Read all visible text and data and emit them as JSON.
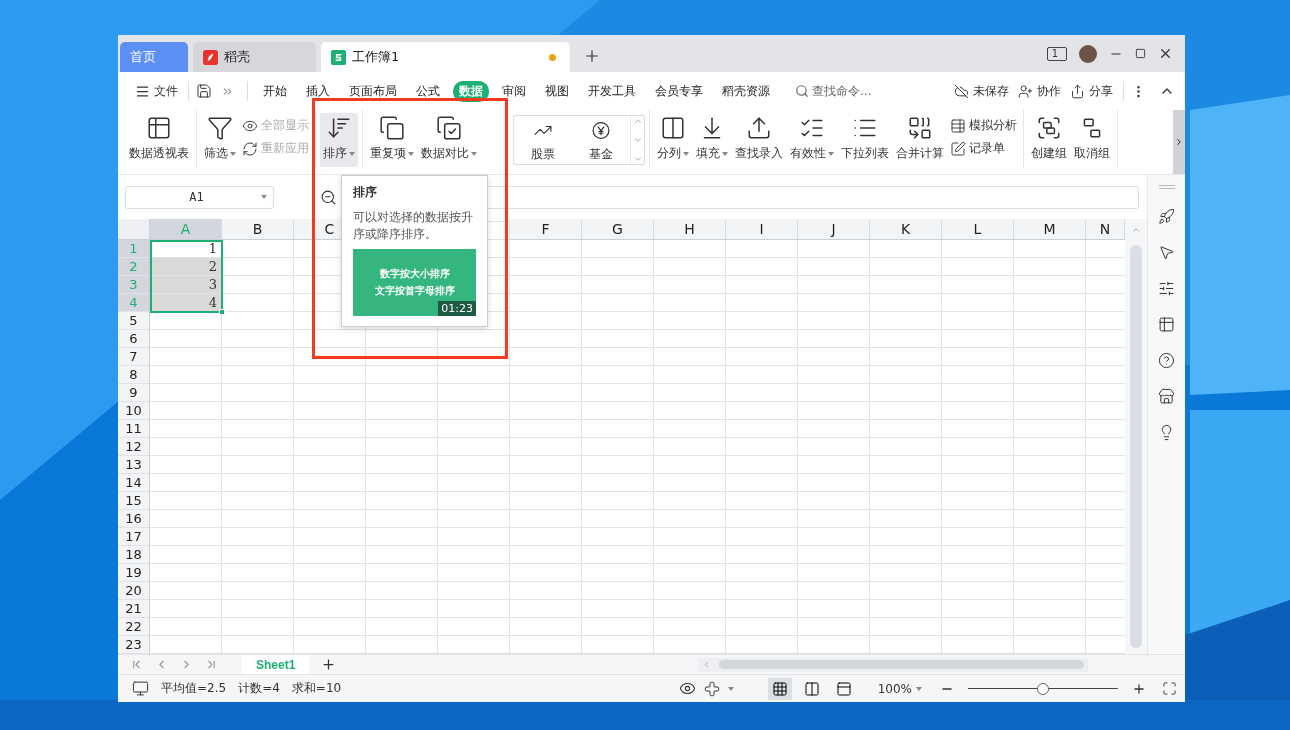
{
  "window_tabs": [
    {
      "label": "首页",
      "kind": "home",
      "selected": false
    },
    {
      "label": "稻壳",
      "kind": "docer",
      "selected": false
    },
    {
      "label": "工作簿1",
      "kind": "sheet",
      "selected": true,
      "unsaved": true
    }
  ],
  "window_count": "1",
  "menu": {
    "file": "文件",
    "tabs": [
      {
        "label": "开始",
        "selected": false
      },
      {
        "label": "插入",
        "selected": false
      },
      {
        "label": "页面布局",
        "selected": false
      },
      {
        "label": "公式",
        "selected": false
      },
      {
        "label": "数据",
        "selected": true
      },
      {
        "label": "审阅",
        "selected": false
      },
      {
        "label": "视图",
        "selected": false
      },
      {
        "label": "开发工具",
        "selected": false
      },
      {
        "label": "会员专享",
        "selected": false
      },
      {
        "label": "稻壳资源",
        "selected": false
      }
    ],
    "search": {
      "placeholder": "查找命令..."
    },
    "actions": [
      "未保存",
      "协作",
      "分享"
    ]
  },
  "ribbon_groups": [
    {
      "items": [
        {
          "kind": "large",
          "label": "数据透视表",
          "caret": false,
          "hovered": false
        }
      ]
    },
    {
      "items": [
        {
          "kind": "large",
          "label": "筛选",
          "caret": true,
          "hovered": false
        },
        {
          "kind": "pair",
          "entries": [
            {
              "label": "全部显示",
              "disabled": true
            },
            {
              "label": "重新应用",
              "disabled": true
            }
          ]
        }
      ]
    },
    {
      "items": [
        {
          "kind": "large",
          "label": "排序",
          "caret": true,
          "hovered": true
        }
      ]
    },
    {
      "items": [
        {
          "kind": "large",
          "label": "重复项",
          "caret": true,
          "hovered": false
        },
        {
          "kind": "large",
          "label": "数据对比",
          "caret": true,
          "hovered": false
        },
        {
          "kind": "gallery",
          "entries": [
            {
              "label": "股票"
            },
            {
              "label": "基金"
            }
          ]
        }
      ]
    },
    {
      "items": [
        {
          "kind": "large",
          "label": "分列",
          "caret": true,
          "hovered": false
        },
        {
          "kind": "large",
          "label": "填充",
          "caret": true,
          "hovered": false
        },
        {
          "kind": "large",
          "label": "查找录入",
          "caret": false,
          "hovered": false
        },
        {
          "kind": "large",
          "label": "有效性",
          "caret": true,
          "hovered": false
        },
        {
          "kind": "large",
          "label": "下拉列表",
          "caret": false,
          "hovered": false
        },
        {
          "kind": "large",
          "label": "合并计算",
          "caret": false,
          "hovered": false
        },
        {
          "kind": "pair",
          "entries": [
            {
              "label": "模拟分析",
              "disabled": false
            },
            {
              "label": "记录单",
              "disabled": false
            }
          ]
        }
      ]
    },
    {
      "items": [
        {
          "kind": "large",
          "label": "创建组",
          "caret": false,
          "hovered": false
        },
        {
          "kind": "large",
          "label": "取消组",
          "caret": false,
          "hovered": false
        }
      ]
    }
  ],
  "tooltip": {
    "title": "排序",
    "description": "可以对选择的数据按升序或降序排序。",
    "video": {
      "lines": [
        "数字按大小排序",
        "文字按首字母排序"
      ],
      "duration": "01:23"
    }
  },
  "name_box": {
    "value": "A1"
  },
  "columns": [
    {
      "label": "A",
      "selected": true
    },
    {
      "label": "B",
      "selected": false
    },
    {
      "label": "C",
      "selected": false
    },
    {
      "label": "F",
      "selected": false
    },
    {
      "label": "G",
      "selected": false
    },
    {
      "label": "H",
      "selected": false
    },
    {
      "label": "I",
      "selected": false
    },
    {
      "label": "J",
      "selected": false
    },
    {
      "label": "K",
      "selected": false
    },
    {
      "label": "L",
      "selected": false
    },
    {
      "label": "M",
      "selected": false
    },
    {
      "label": "N",
      "selected": false
    }
  ],
  "rows": [
    {
      "label": "1",
      "selected": true,
      "cells": [
        {
          "value": "1",
          "shaded": false
        }
      ]
    },
    {
      "label": "2",
      "selected": true,
      "cells": [
        {
          "value": "2",
          "shaded": true
        }
      ]
    },
    {
      "label": "3",
      "selected": true,
      "cells": [
        {
          "value": "3",
          "shaded": true
        }
      ]
    },
    {
      "label": "4",
      "selected": true,
      "cells": [
        {
          "value": "4",
          "shaded": true
        }
      ]
    },
    {
      "label": "5",
      "selected": false,
      "cells": []
    },
    {
      "label": "6",
      "selected": false,
      "cells": []
    },
    {
      "label": "7",
      "selected": false,
      "cells": []
    },
    {
      "label": "8",
      "selected": false,
      "cells": []
    },
    {
      "label": "9",
      "selected": false,
      "cells": []
    },
    {
      "label": "10",
      "selected": false,
      "cells": []
    },
    {
      "label": "11",
      "selected": false,
      "cells": []
    },
    {
      "label": "12",
      "selected": false,
      "cells": []
    },
    {
      "label": "13",
      "selected": false,
      "cells": []
    },
    {
      "label": "14",
      "selected": false,
      "cells": []
    },
    {
      "label": "15",
      "selected": false,
      "cells": []
    },
    {
      "label": "16",
      "selected": false,
      "cells": []
    },
    {
      "label": "17",
      "selected": false,
      "cells": []
    },
    {
      "label": "18",
      "selected": false,
      "cells": []
    },
    {
      "label": "19",
      "selected": false,
      "cells": []
    },
    {
      "label": "20",
      "selected": false,
      "cells": []
    },
    {
      "label": "21",
      "selected": false,
      "cells": []
    },
    {
      "label": "22",
      "selected": false,
      "cells": []
    },
    {
      "label": "23",
      "selected": false,
      "cells": []
    }
  ],
  "sheet_tabs": [
    {
      "label": "Sheet1",
      "selected": true
    }
  ],
  "status": {
    "stats": [
      "平均值=2.5",
      "计数=4",
      "求和=10"
    ],
    "views": [
      {
        "selected": true
      },
      {
        "selected": false
      },
      {
        "selected": false
      }
    ],
    "zoom": "100%",
    "zoom_slider": {
      "level": 0.5
    }
  }
}
